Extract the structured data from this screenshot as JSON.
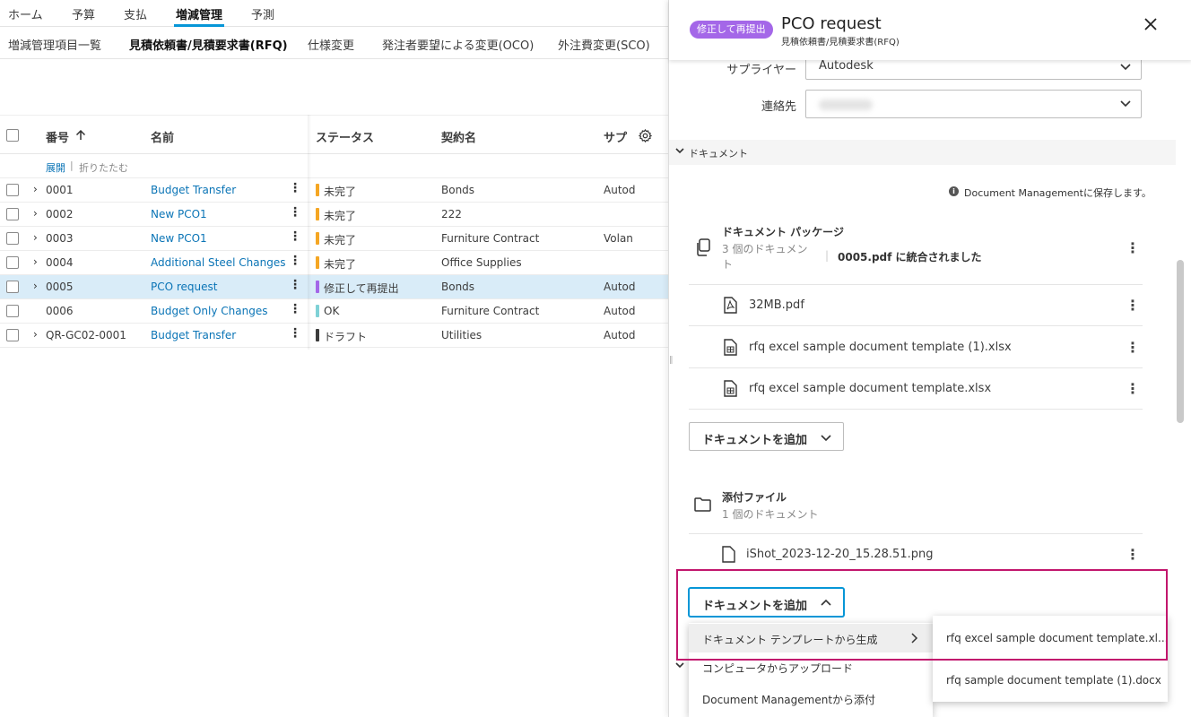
{
  "topnav": {
    "tabs": [
      "ホーム",
      "予算",
      "支払",
      "増減管理",
      "予測"
    ],
    "active": "増減管理"
  },
  "subnav": {
    "tabs": [
      "増減管理項目一覧",
      "見積依頼書/見積要求書(RFQ)",
      "仕様変更",
      "発注者要望による変更(OCO)",
      "外注費変更(SCO)"
    ]
  },
  "table": {
    "headers": {
      "number": "番号",
      "name": "名前",
      "status": "ステータス",
      "contract": "契約名",
      "supplier": "サプ"
    },
    "expand": "展開",
    "collapse": "折りたたむ",
    "rows": [
      {
        "number": "0001",
        "name": "Budget Transfer",
        "status": "未完了",
        "contract": "Bonds",
        "supplier": "Autod"
      },
      {
        "number": "0002",
        "name": "New PCO1",
        "status": "未完了",
        "contract": "222",
        "supplier": ""
      },
      {
        "number": "0003",
        "name": "New PCO1",
        "status": "未完了",
        "contract": "Furniture Contract",
        "supplier": "Volan"
      },
      {
        "number": "0004",
        "name": "Additional Steel Changes",
        "status": "未完了",
        "contract": "Office Supplies",
        "supplier": ""
      },
      {
        "number": "0005",
        "name": "PCO request",
        "status": "修正して再提出",
        "contract": "Bonds",
        "supplier": "Autod"
      },
      {
        "number": "0006",
        "name": "Budget Only Changes",
        "status": "OK",
        "contract": "Furniture Contract",
        "supplier": "Autod"
      },
      {
        "number": "QR-GC02-0001",
        "name": "Budget Transfer",
        "status": "ドラフト",
        "contract": "Utilities",
        "supplier": "Autod"
      }
    ]
  },
  "status_colors": {
    "incomplete": "#f5a623",
    "resubmit": "#a467e8",
    "ok": "#7fd1d6",
    "draft": "#3c3c3c"
  },
  "panel": {
    "badge": "修正して再提出",
    "title": "PCO request",
    "subtitle": "見積依頼書/見積要求書(RFQ)",
    "supplier_label": "サプライヤー",
    "supplier_value": "Autodesk",
    "contact_label": "連絡先",
    "documents_section": "ドキュメント",
    "save_note": "Document Managementに保存します。",
    "package": {
      "title": "ドキュメント パッケージ",
      "count_line1": "3 個のドキュメン",
      "count_line2": "ト",
      "merged": "0005.pdf に統合されました"
    },
    "files": [
      "32MB.pdf",
      "rfq excel sample document template (1).xlsx",
      "rfq excel sample document template.xlsx"
    ],
    "add_doc_button": "ドキュメントを追加",
    "attachments": {
      "title": "添付ファイル",
      "count": "1 個のドキュメント",
      "file": "iShot_2023-12-20_15.28.51.png"
    },
    "add_menu": {
      "items": [
        "ドキュメント テンプレートから生成",
        "コンピュータからアップロード",
        "Document Managementから添付"
      ]
    },
    "template_submenu": [
      "rfq excel sample document template.xl...",
      "rfq sample document template (1).docx"
    ]
  }
}
